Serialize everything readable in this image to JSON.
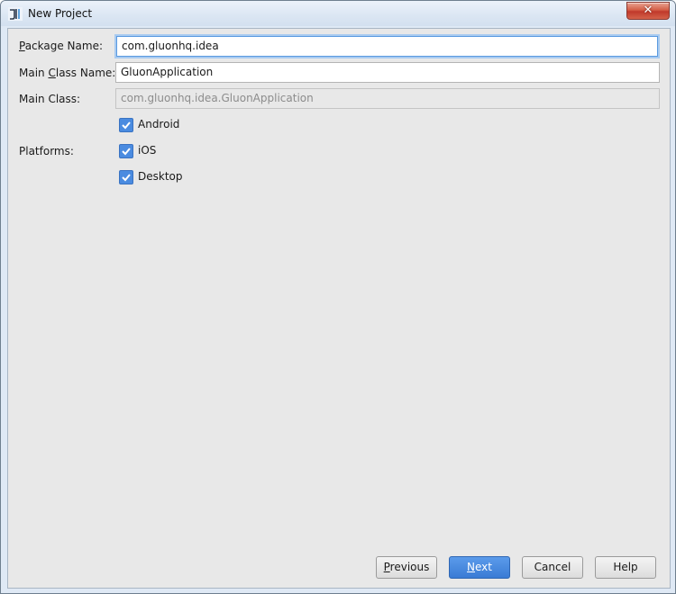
{
  "window": {
    "title": "New Project",
    "close_symbol": "✕"
  },
  "form": {
    "package_name": {
      "label_mnemonic": "P",
      "label_rest": "ackage Name:",
      "value": "com.gluonhq.idea"
    },
    "main_class_name": {
      "label_before": "Main ",
      "label_mnemonic": "C",
      "label_after": "lass Name:",
      "value": "GluonApplication"
    },
    "main_class": {
      "label": "Main Class:",
      "value": "com.gluonhq.idea.GluonApplication"
    },
    "platforms_label": "Platforms:",
    "platforms": [
      {
        "label": "Android",
        "checked": true
      },
      {
        "label": "iOS",
        "checked": true
      },
      {
        "label": "Desktop",
        "checked": true
      }
    ]
  },
  "buttons": {
    "previous": {
      "mnemonic": "P",
      "rest": "revious"
    },
    "next": {
      "mnemonic": "N",
      "rest": "ext"
    },
    "cancel": "Cancel",
    "help": "Help"
  },
  "colors": {
    "accent": "#3a7bd5",
    "checkbox": "#4a8be0",
    "dialog_background": "#e8e8e8",
    "close_button": "#c0392b"
  },
  "icons": {
    "app": "intellij-idea-icon",
    "close": "close-icon",
    "check": "checkmark-icon"
  }
}
